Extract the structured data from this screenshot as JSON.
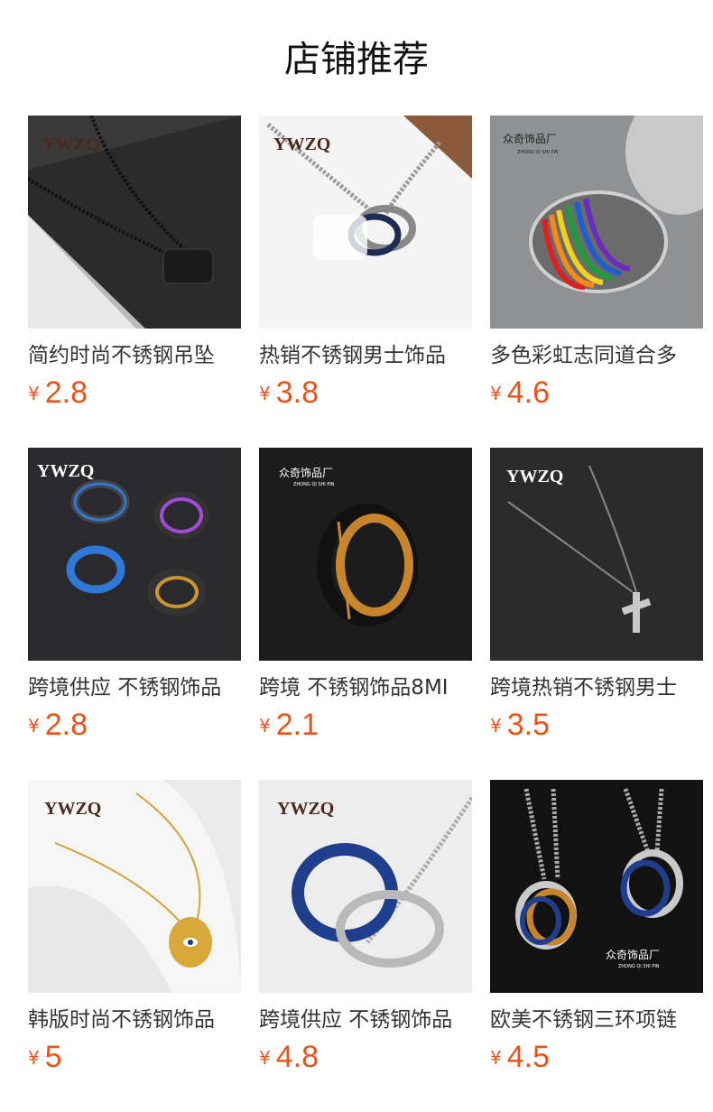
{
  "section_title": "店铺推荐",
  "brands": {
    "ywzq": "YWZQ",
    "zhongqi": "众奇饰品厂",
    "zhongqi_pinyin": "ZHONG QI SHI PIN"
  },
  "currency_symbol": "¥",
  "colors": {
    "price": "#e8541a"
  },
  "products": [
    {
      "name": "简约时尚不锈钢吊坠",
      "price": "2.8"
    },
    {
      "name": "热销不锈钢男士饰品",
      "price": "3.8"
    },
    {
      "name": "多色彩虹志同道合多",
      "price": "4.6"
    },
    {
      "name": "跨境供应 不锈钢饰品",
      "price": "2.8"
    },
    {
      "name": "跨境 不锈钢饰品8MI",
      "price": "2.1"
    },
    {
      "name": "跨境热销不锈钢男士",
      "price": "3.5"
    },
    {
      "name": "韩版时尚不锈钢饰品",
      "price": "5"
    },
    {
      "name": "跨境供应 不锈钢饰品",
      "price": "4.8"
    },
    {
      "name": "欧美不锈钢三环项链",
      "price": "4.5"
    }
  ]
}
